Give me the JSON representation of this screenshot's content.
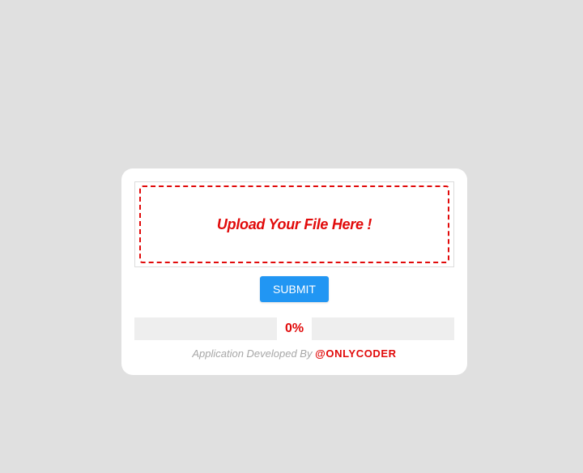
{
  "upload": {
    "prompt": "Upload Your File Here !"
  },
  "form": {
    "submit_label": "SUBMIT"
  },
  "progress": {
    "label": "0%",
    "value": 0
  },
  "footer": {
    "text": "Application Developed By",
    "author": "@ONLYCODER"
  },
  "colors": {
    "background": "#e0e0e0",
    "accent": "#e10a0a",
    "button": "#2196f3",
    "progress_track": "#eeeeee"
  }
}
